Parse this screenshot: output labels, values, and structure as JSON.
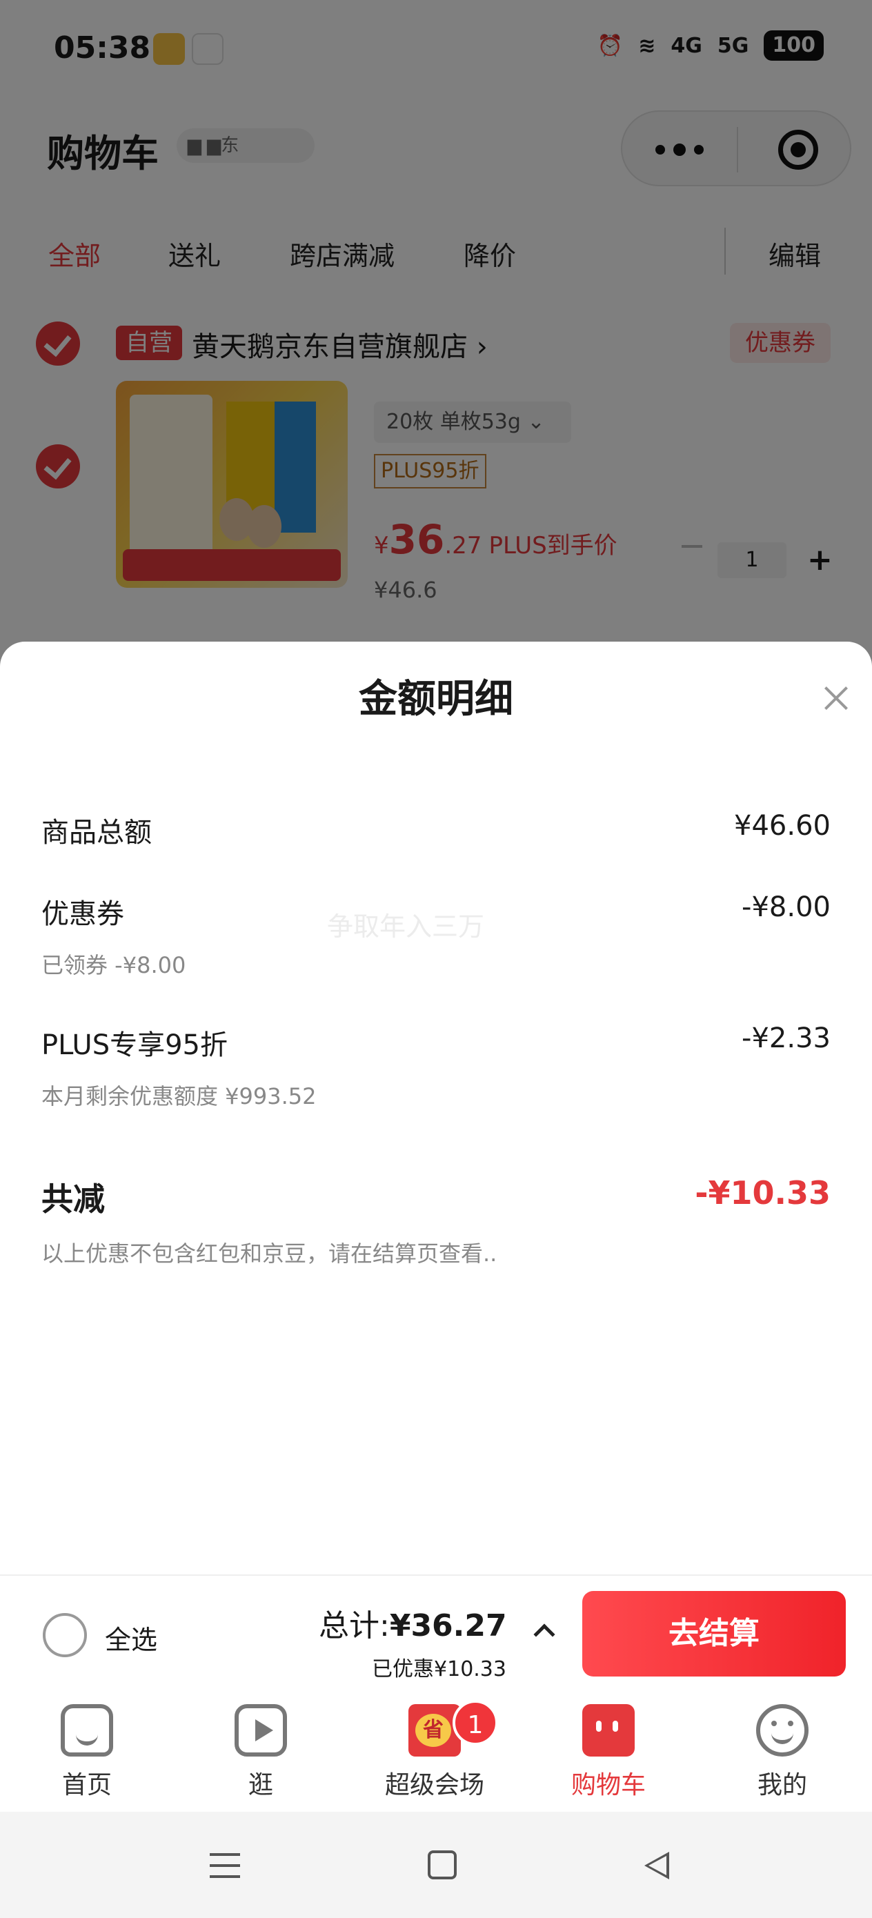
{
  "status_bar": {
    "time": "05:38",
    "network_1": "4G",
    "network_2": "5G",
    "battery": "100"
  },
  "header": {
    "title": "购物车",
    "address": "▆ ▆东"
  },
  "filter_tabs": [
    "全部",
    "送礼",
    "跨店满减",
    "降价"
  ],
  "header_edit": "编辑",
  "shop": {
    "tag": "自营",
    "name": "黄天鹅京东自营旗舰店 ›",
    "coupon": "优惠券",
    "product": {
      "spec": "20枚 单枚53g ⌄",
      "plus_tag": "PLUS95折",
      "price_symbol": "¥",
      "price_int": "36",
      "price_dec": ".27",
      "price_label": "PLUS到手价",
      "original_price": "¥46.6",
      "quantity": "1"
    }
  },
  "sheet": {
    "title": "金额明细",
    "watermark": "争取年入三万",
    "rows": [
      {
        "label": "商品总额",
        "value": "¥46.60",
        "sub": ""
      },
      {
        "label": "优惠券",
        "value": "-¥8.00",
        "sub": "已领券 -¥8.00"
      },
      {
        "label": "PLUS专享95折",
        "value": "-¥2.33",
        "sub": "本月剩余优惠额度 ¥993.52"
      }
    ],
    "total": {
      "label": "共减",
      "value": "-¥10.33",
      "note": "以上优惠不包含红包和京豆，请在结算页查看.."
    }
  },
  "checkout": {
    "select_all": "全选",
    "total_label": "总计:",
    "total_value": "¥36.27",
    "saved": "已优惠¥10.33",
    "button": "去结算"
  },
  "tab_bar": {
    "items": [
      {
        "label": "首页",
        "icon": "home-icon"
      },
      {
        "label": "逛",
        "icon": "play-icon"
      },
      {
        "label": "超级会场",
        "icon": "venue-icon",
        "badge": "1"
      },
      {
        "label": "购物车",
        "icon": "cart-icon",
        "active": true
      },
      {
        "label": "我的",
        "icon": "smile-icon"
      }
    ]
  },
  "colors": {
    "accent": "#e4393c",
    "overlay": "rgba(0,0,0,0.5)"
  }
}
